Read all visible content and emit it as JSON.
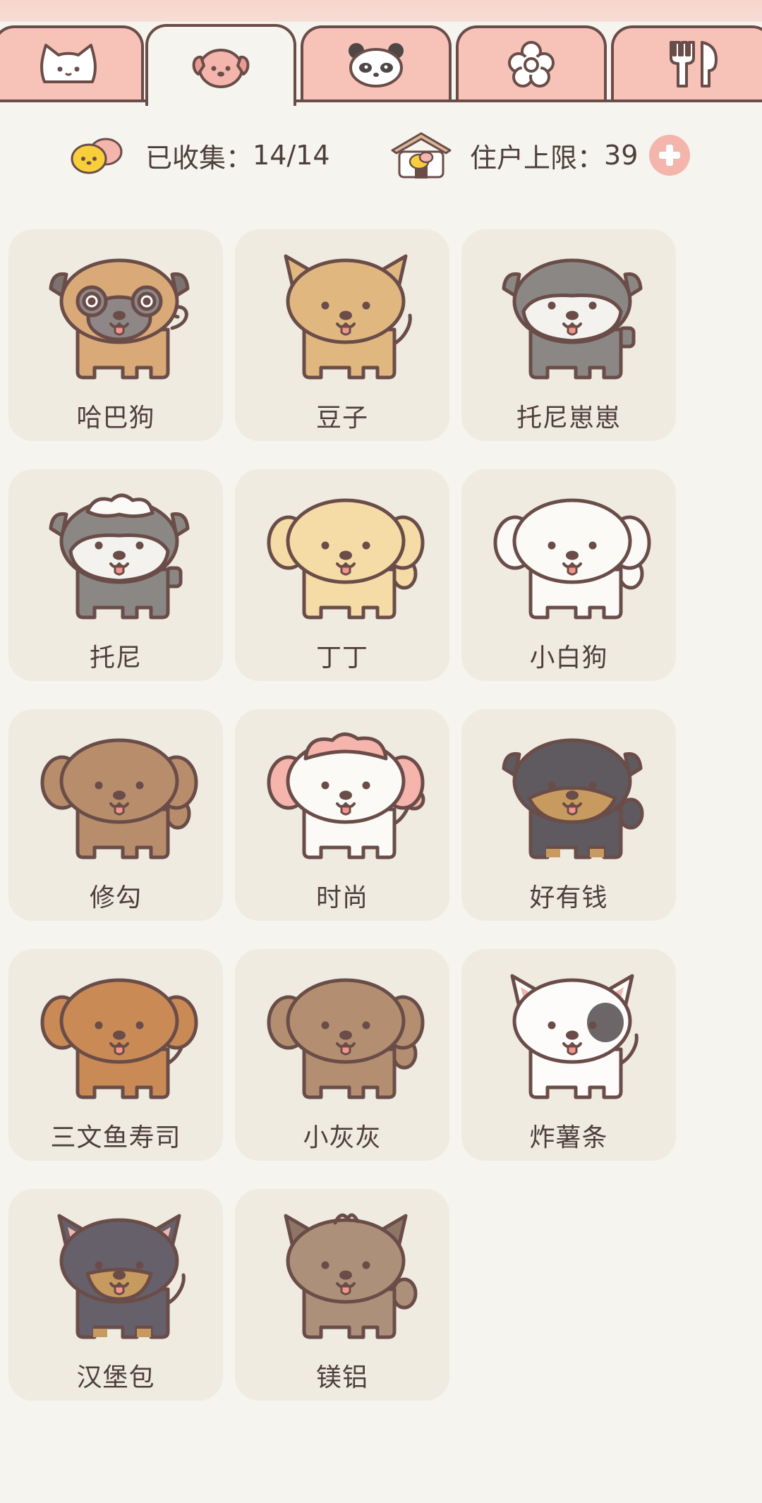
{
  "tabs": [
    {
      "name": "cat",
      "icon": "cat-face-icon",
      "active": false
    },
    {
      "name": "dog",
      "icon": "dog-face-icon",
      "active": true
    },
    {
      "name": "panda",
      "icon": "panda-face-icon",
      "active": false
    },
    {
      "name": "flower",
      "icon": "flower-icon",
      "active": false
    },
    {
      "name": "utensils",
      "icon": "fork-spoon-icon",
      "active": false
    }
  ],
  "stats": {
    "collected_label": "已收集：",
    "collected_value": "14/14",
    "capacity_label": "住户上限：",
    "capacity_value": "39"
  },
  "dogs": [
    {
      "name": "哈巴狗",
      "body": "#d9a978",
      "ear": "#7d7270",
      "mask": "#8f8787",
      "tail": "curl",
      "style": "pug"
    },
    {
      "name": "豆子",
      "body": "#dfb77f",
      "ear": "#dfb77f",
      "mask": null,
      "tail": "up",
      "style": "shiba"
    },
    {
      "name": "托尼崽崽",
      "body": "#8b8784",
      "ear": "#8b8784",
      "mask": "#f4f2ee",
      "tail": "stub",
      "style": "schnauzer"
    },
    {
      "name": "托尼",
      "body": "#8b8784",
      "ear": "#8b8784",
      "mask": "#f4f2ee",
      "tail": "stub",
      "style": "schnauzer-fluff"
    },
    {
      "name": "丁丁",
      "body": "#f5dba6",
      "ear": "#f5dba6",
      "mask": null,
      "tail": "fluff",
      "style": "floppy"
    },
    {
      "name": "小白狗",
      "body": "#fbfaf7",
      "ear": "#fbfaf7",
      "mask": null,
      "tail": "fluff",
      "style": "floppy"
    },
    {
      "name": "修勾",
      "body": "#b78d6c",
      "ear": "#b78d6c",
      "mask": null,
      "tail": "fluff",
      "style": "floppy"
    },
    {
      "name": "时尚",
      "body": "#fbfaf7",
      "ear": "#f5b4ac",
      "mask": null,
      "tail": "pom",
      "style": "poodle"
    },
    {
      "name": "好有钱",
      "body": "#5e5a60",
      "ear": "#5e5a60",
      "mask": "#c79a5f",
      "tail": "fluff",
      "style": "rott"
    },
    {
      "name": "三文鱼寿司",
      "body": "#c98a55",
      "ear": "#c98a55",
      "mask": null,
      "tail": "up",
      "style": "dachs"
    },
    {
      "name": "小灰灰",
      "body": "#b38e70",
      "ear": "#b38e70",
      "mask": null,
      "tail": "fluff",
      "style": "floppy"
    },
    {
      "name": "炸薯条",
      "body": "#fdfcfa",
      "ear": "#fdfcfa",
      "mask": "#6d6668",
      "tail": "up",
      "style": "bullterrier"
    },
    {
      "name": "汉堡包",
      "body": "#66606a",
      "ear": "#66606a",
      "mask": "#c79a5f",
      "tail": "up",
      "style": "chihuahua"
    },
    {
      "name": "镁铝",
      "body": "#ad9079",
      "ear": "#8e7666",
      "mask": null,
      "tail": "fluff",
      "style": "yorkie"
    }
  ]
}
